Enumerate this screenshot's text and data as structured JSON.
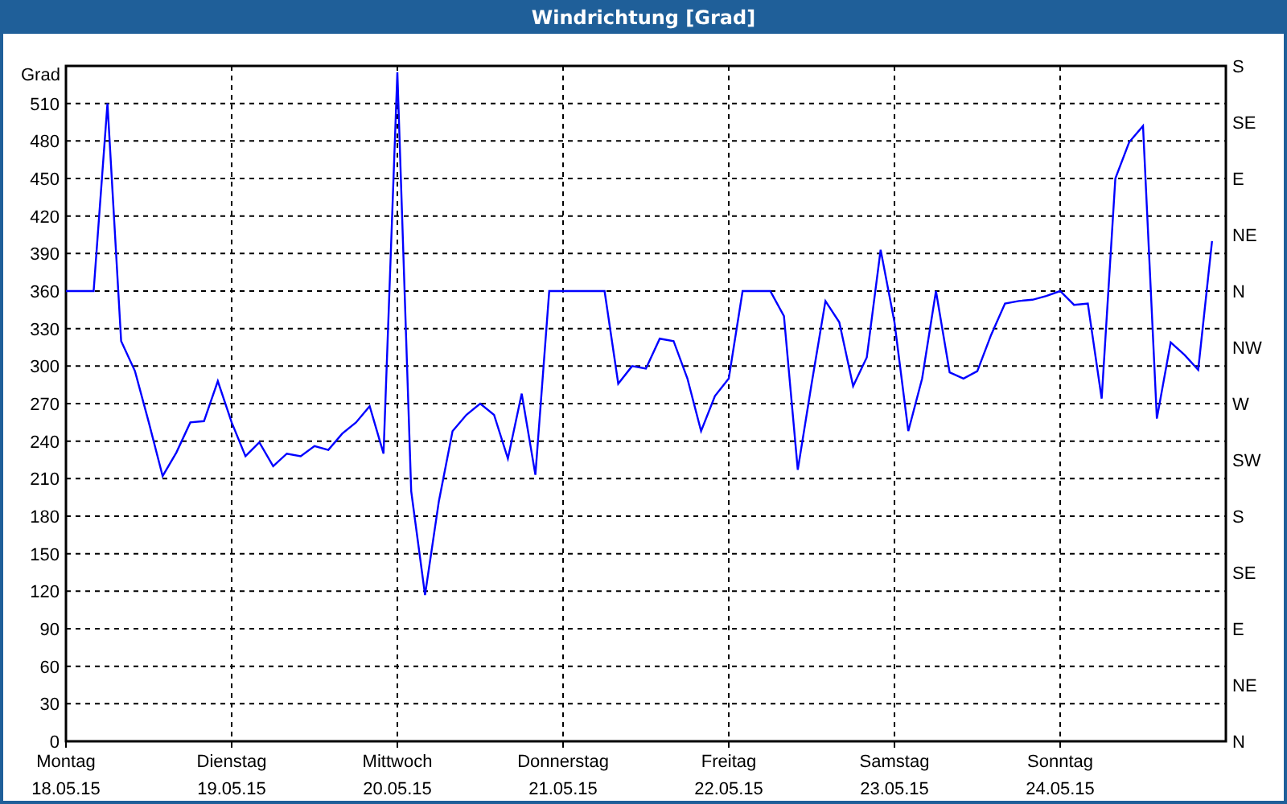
{
  "window": {
    "title": "Windrichtung [Grad]"
  },
  "chart": {
    "right_axis_labels": [
      "S",
      "SE",
      "E",
      "NE",
      "N",
      "NW",
      "W",
      "SW",
      "S",
      "SE",
      "E",
      "NE",
      "N"
    ],
    "x_dates": [
      "18.05.15",
      "19.05.15",
      "20.05.15",
      "21.05.15",
      "22.05.15",
      "23.05.15",
      "24.05.15"
    ],
    "chart_data": {
      "type": "line",
      "grid": true,
      "ylabel": "Grad",
      "ylim": [
        0,
        540
      ],
      "yticks": [
        0,
        30,
        60,
        90,
        120,
        150,
        180,
        210,
        240,
        270,
        300,
        330,
        360,
        390,
        420,
        450,
        480,
        510
      ],
      "categories": [
        "Montag",
        null,
        null,
        null,
        null,
        null,
        null,
        null,
        null,
        null,
        null,
        null,
        "Dienstag",
        null,
        null,
        null,
        null,
        null,
        null,
        null,
        null,
        null,
        null,
        null,
        "Mittwoch",
        null,
        null,
        null,
        null,
        null,
        null,
        null,
        null,
        null,
        null,
        null,
        "Donnerstag",
        null,
        null,
        null,
        null,
        null,
        null,
        null,
        null,
        null,
        null,
        null,
        "Freitag",
        null,
        null,
        null,
        null,
        null,
        null,
        null,
        null,
        null,
        null,
        null,
        "Samstag",
        null,
        null,
        null,
        null,
        null,
        null,
        null,
        null,
        null,
        null,
        null,
        "Sonntag",
        null,
        null,
        null,
        null,
        null,
        null,
        null,
        null,
        null,
        null,
        null
      ],
      "series": [
        {
          "color": "#0000ff",
          "values": [
            360,
            360,
            360,
            510,
            320,
            296,
            255,
            212,
            231,
            255,
            256,
            288,
            255,
            228,
            239,
            220,
            230,
            228,
            236,
            233,
            246,
            255,
            268,
            230,
            535,
            200,
            117,
            192,
            248,
            261,
            270,
            261,
            226,
            278,
            213,
            360,
            360,
            360,
            360,
            360,
            286,
            300,
            298,
            322,
            320,
            290,
            248,
            276,
            290,
            360,
            360,
            360,
            340,
            217,
            286,
            352,
            335,
            284,
            307,
            393,
            335,
            248,
            290,
            360,
            295,
            290,
            296,
            325,
            350,
            352,
            353,
            356,
            360,
            349,
            350,
            274,
            450,
            479,
            492,
            258,
            319,
            309,
            297,
            400
          ]
        }
      ]
    }
  }
}
